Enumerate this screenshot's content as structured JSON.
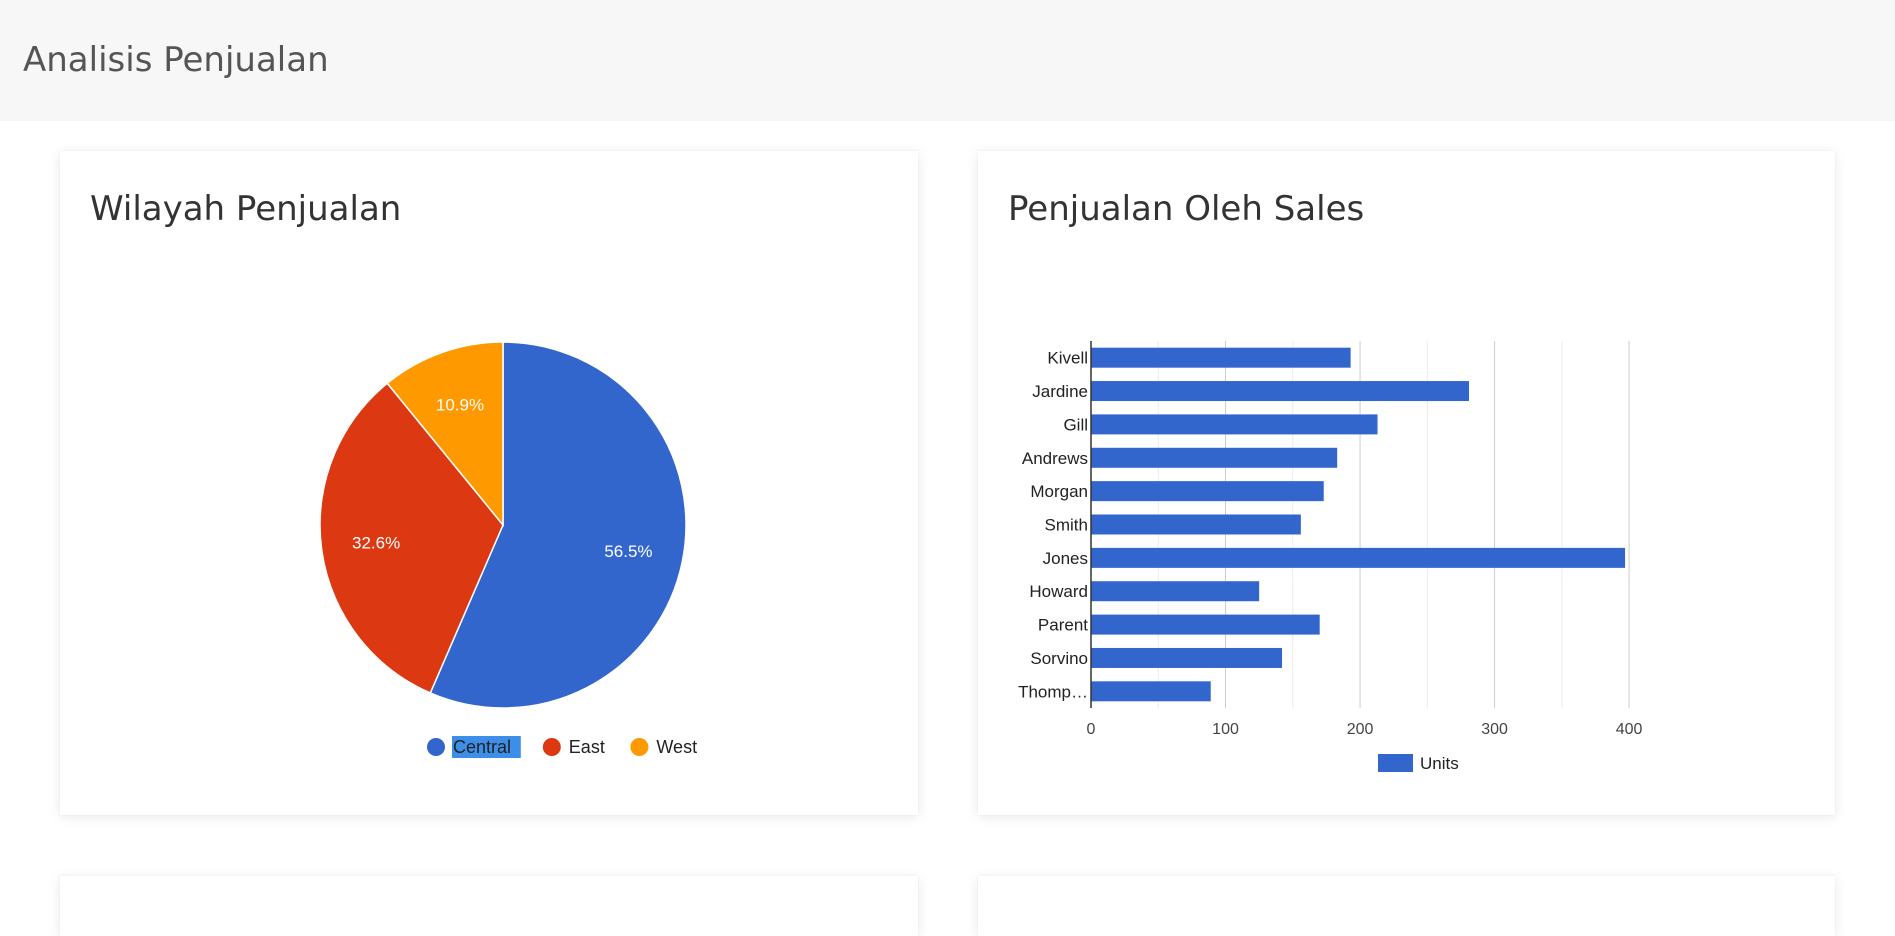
{
  "header": {
    "title": "Analisis Penjualan"
  },
  "cards": {
    "region": {
      "title": "Wilayah Penjualan"
    },
    "sales": {
      "title": "Penjualan Oleh Sales"
    }
  },
  "chart_data": [
    {
      "type": "pie",
      "title": "Wilayah Penjualan",
      "slices": [
        {
          "label": "Central",
          "value": 56.5,
          "display": "56.5%",
          "color": "#3366cc"
        },
        {
          "label": "East",
          "value": 32.6,
          "display": "32.6%",
          "color": "#dc3912"
        },
        {
          "label": "West",
          "value": 10.9,
          "display": "10.9%",
          "color": "#ff9900"
        }
      ],
      "legend_position": "bottom",
      "selected_legend": "Central"
    },
    {
      "type": "bar",
      "orientation": "horizontal",
      "title": "Penjualan Oleh Sales",
      "categories": [
        "Kivell",
        "Jardine",
        "Gill",
        "Andrews",
        "Morgan",
        "Smith",
        "Jones",
        "Howard",
        "Parent",
        "Sorvino",
        "Thomp…"
      ],
      "series": [
        {
          "name": "Units",
          "color": "#3366cc",
          "values": [
            193,
            281,
            213,
            183,
            173,
            156,
            397,
            125,
            170,
            142,
            89
          ]
        }
      ],
      "xticks": [
        "0",
        "100",
        "200",
        "300",
        "400"
      ],
      "xlim": [
        0,
        400
      ],
      "grid": true,
      "legend_position": "bottom"
    }
  ]
}
